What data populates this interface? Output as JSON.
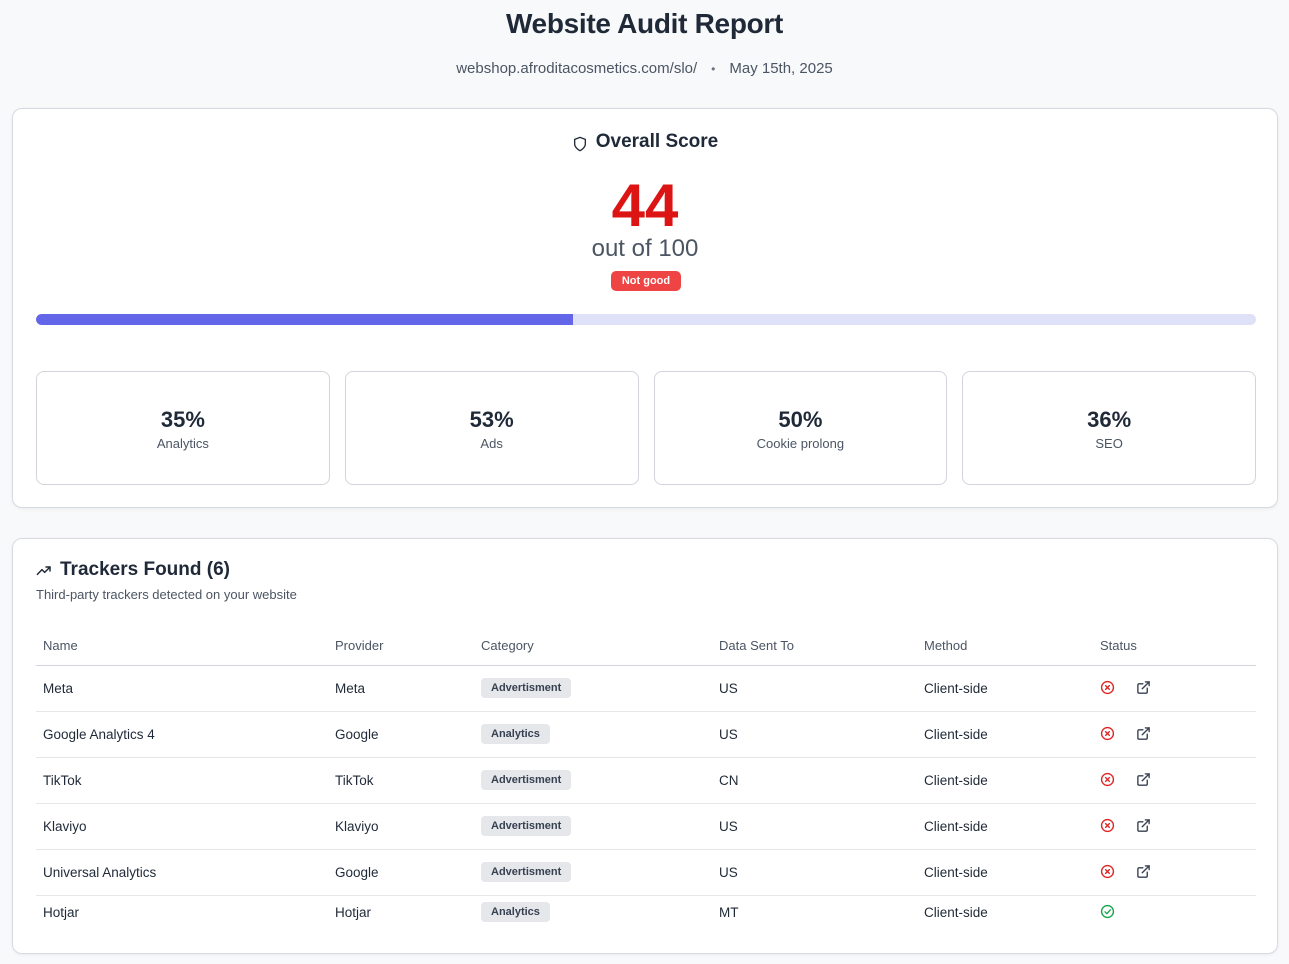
{
  "header": {
    "title": "Website Audit Report",
    "url": "webshop.afroditacosmetics.com/slo/",
    "separator": "•",
    "date": "May 15th, 2025"
  },
  "score": {
    "heading": "Overall Score",
    "heading_icon": "shield-icon",
    "value": "44",
    "out_of": "out of 100",
    "badge": "Not good",
    "progress_percent": 44,
    "colors": {
      "score": "#dc1414",
      "badge": "#ef4444",
      "bar_fill": "#6366e9",
      "bar_track": "#dfe1f9"
    }
  },
  "metrics": [
    {
      "value": "35%",
      "label": "Analytics"
    },
    {
      "value": "53%",
      "label": "Ads"
    },
    {
      "value": "50%",
      "label": "Cookie prolong"
    },
    {
      "value": "36%",
      "label": "SEO"
    }
  ],
  "trackers": {
    "heading": "Trackers Found (6)",
    "heading_icon": "trending-up-icon",
    "subtitle": "Third-party trackers detected on your website",
    "columns": [
      "Name",
      "Provider",
      "Category",
      "Data Sent To",
      "Method",
      "Status"
    ],
    "rows": [
      {
        "name": "Meta",
        "provider": "Meta",
        "category": "Advertisment",
        "data_sent_to": "US",
        "method": "Client-side",
        "status": "blocked"
      },
      {
        "name": "Google Analytics 4",
        "provider": "Google",
        "category": "Analytics",
        "data_sent_to": "US",
        "method": "Client-side",
        "status": "blocked"
      },
      {
        "name": "TikTok",
        "provider": "TikTok",
        "category": "Advertisment",
        "data_sent_to": "CN",
        "method": "Client-side",
        "status": "blocked"
      },
      {
        "name": "Klaviyo",
        "provider": "Klaviyo",
        "category": "Advertisment",
        "data_sent_to": "US",
        "method": "Client-side",
        "status": "blocked"
      },
      {
        "name": "Universal Analytics",
        "provider": "Google",
        "category": "Advertisment",
        "data_sent_to": "US",
        "method": "Client-side",
        "status": "blocked"
      },
      {
        "name": "Hotjar",
        "provider": "Hotjar",
        "category": "Analytics",
        "data_sent_to": "MT",
        "method": "Client-side",
        "status": "ok"
      }
    ]
  }
}
